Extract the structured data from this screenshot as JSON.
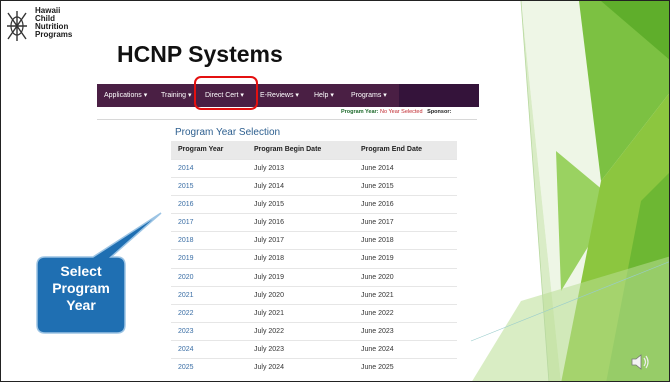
{
  "logo": {
    "line1": "Hawaii",
    "line2": "Child",
    "line3": "Nutrition",
    "line4": "Programs"
  },
  "title": "HCNP Systems",
  "nav": {
    "items": [
      "Applications ▾",
      "Training ▾",
      "Direct Cert ▾",
      "E-Reviews ▾",
      "Help ▾",
      "Programs ▾"
    ]
  },
  "status": {
    "program_year_label": "Program Year:",
    "program_year_value": "No Year Selected",
    "sponsor_label": "Sponsor:"
  },
  "section_title": "Program Year Selection",
  "table": {
    "headers": [
      "Program Year",
      "Program Begin Date",
      "Program End Date"
    ],
    "rows": [
      [
        "2014",
        "July 2013",
        "June 2014"
      ],
      [
        "2015",
        "July 2014",
        "June 2015"
      ],
      [
        "2016",
        "July 2015",
        "June 2016"
      ],
      [
        "2017",
        "July 2016",
        "June 2017"
      ],
      [
        "2018",
        "July 2017",
        "June 2018"
      ],
      [
        "2019",
        "July 2018",
        "June 2019"
      ],
      [
        "2020",
        "July 2019",
        "June 2020"
      ],
      [
        "2021",
        "July 2020",
        "June 2021"
      ],
      [
        "2022",
        "July 2021",
        "June 2022"
      ],
      [
        "2023",
        "July 2022",
        "June 2023"
      ],
      [
        "2024",
        "July 2023",
        "June 2024"
      ],
      [
        "2025",
        "July 2024",
        "June 2025"
      ]
    ]
  },
  "callout": {
    "line1": "Select",
    "line2": "Program",
    "line3": "Year"
  },
  "colors": {
    "navbar": "#4a1f44",
    "highlight": "#e41010",
    "callout": "#1f6fb2",
    "accent_green": "#8cc63f"
  },
  "icons": {
    "audio": "speaker-icon"
  }
}
